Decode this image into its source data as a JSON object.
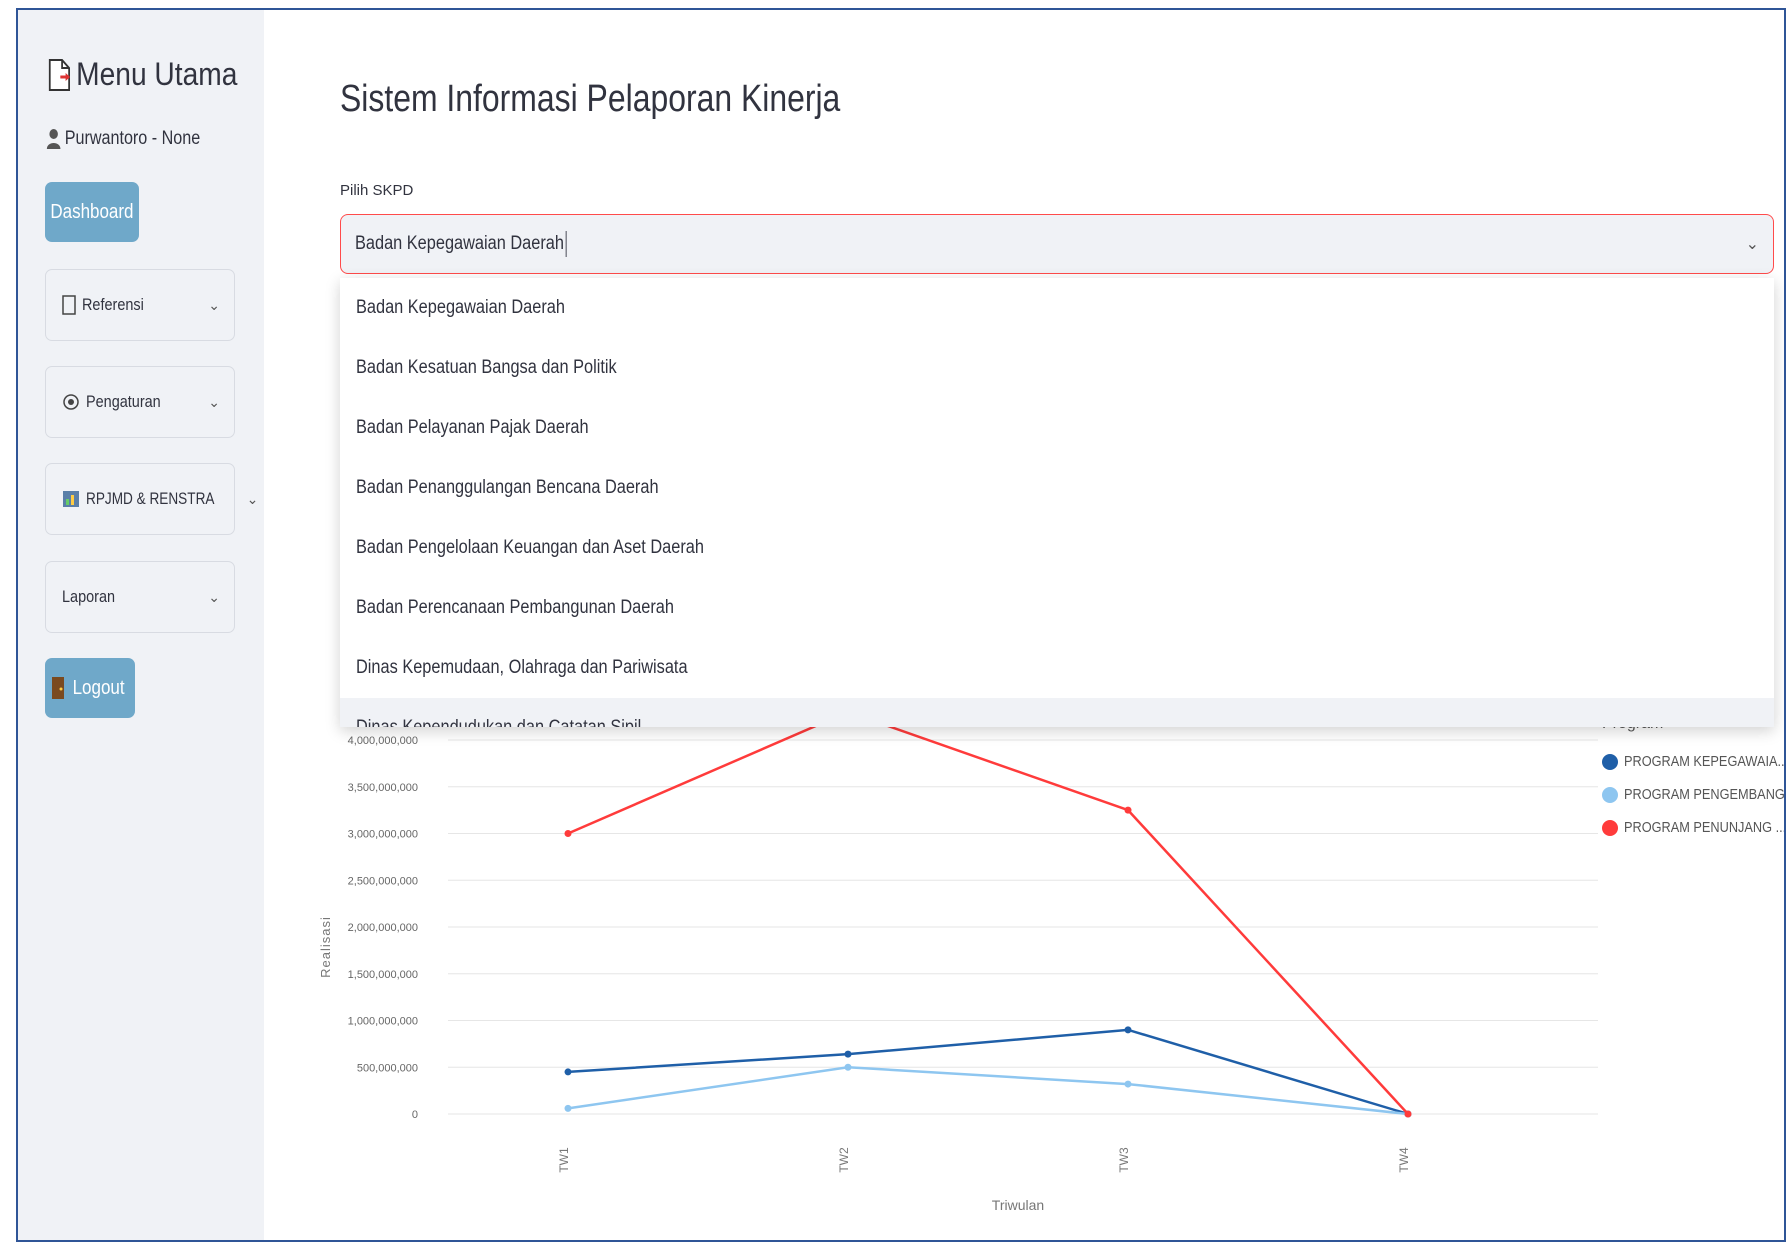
{
  "sidebar": {
    "menu_title": "Menu Utama",
    "user": "Purwantoro - None",
    "dashboard_label": "Dashboard",
    "items": [
      {
        "label": "Referensi",
        "icon": "document-icon"
      },
      {
        "label": "Pengaturan",
        "icon": "gear-icon"
      },
      {
        "label": "RPJMD & RENSTRA",
        "icon": "chart-icon"
      },
      {
        "label": "Laporan",
        "icon": ""
      }
    ],
    "logout_label": "Logout"
  },
  "main": {
    "title": "Sistem Informasi Pelaporan Kinerja",
    "select_label": "Pilih SKPD",
    "select_value": "Badan Kepegawaian Daerah",
    "options": [
      "Badan Kepegawaian Daerah",
      "Badan Kesatuan Bangsa dan Politik",
      "Badan Pelayanan Pajak Daerah",
      "Badan Penanggulangan Bencana Daerah",
      "Badan Pengelolaan Keuangan dan Aset Daerah",
      "Badan Perencanaan Pembangunan Daerah",
      "Dinas Kepemudaan, Olahraga dan Pariwisata",
      "Dinas Kependudukan dan Catatan Sipil"
    ]
  },
  "chart_data": {
    "type": "line",
    "xlabel": "Triwulan",
    "ylabel": "Realisasi",
    "categories": [
      "TW1",
      "TW2",
      "TW3",
      "TW4"
    ],
    "yticks": [
      "0",
      "500,000,000",
      "1,000,000,000",
      "1,500,000,000",
      "2,000,000,000",
      "2,500,000,000",
      "3,000,000,000",
      "3,500,000,000",
      "4,000,000,000"
    ],
    "ylim": [
      0,
      4000000000
    ],
    "legend_title": "Program",
    "series": [
      {
        "name": "PROGRAM KEPEGAWAIA...",
        "color": "#1f5fa8",
        "values": [
          450000000,
          640000000,
          900000000,
          0
        ]
      },
      {
        "name": "PROGRAM PENGEMBANG...",
        "color": "#8ec6f0",
        "values": [
          60000000,
          500000000,
          320000000,
          0
        ]
      },
      {
        "name": "PROGRAM PENUNJANG ...",
        "color": "#ff3b3b",
        "values": [
          3000000000,
          4300000000,
          3250000000,
          0
        ]
      }
    ]
  }
}
